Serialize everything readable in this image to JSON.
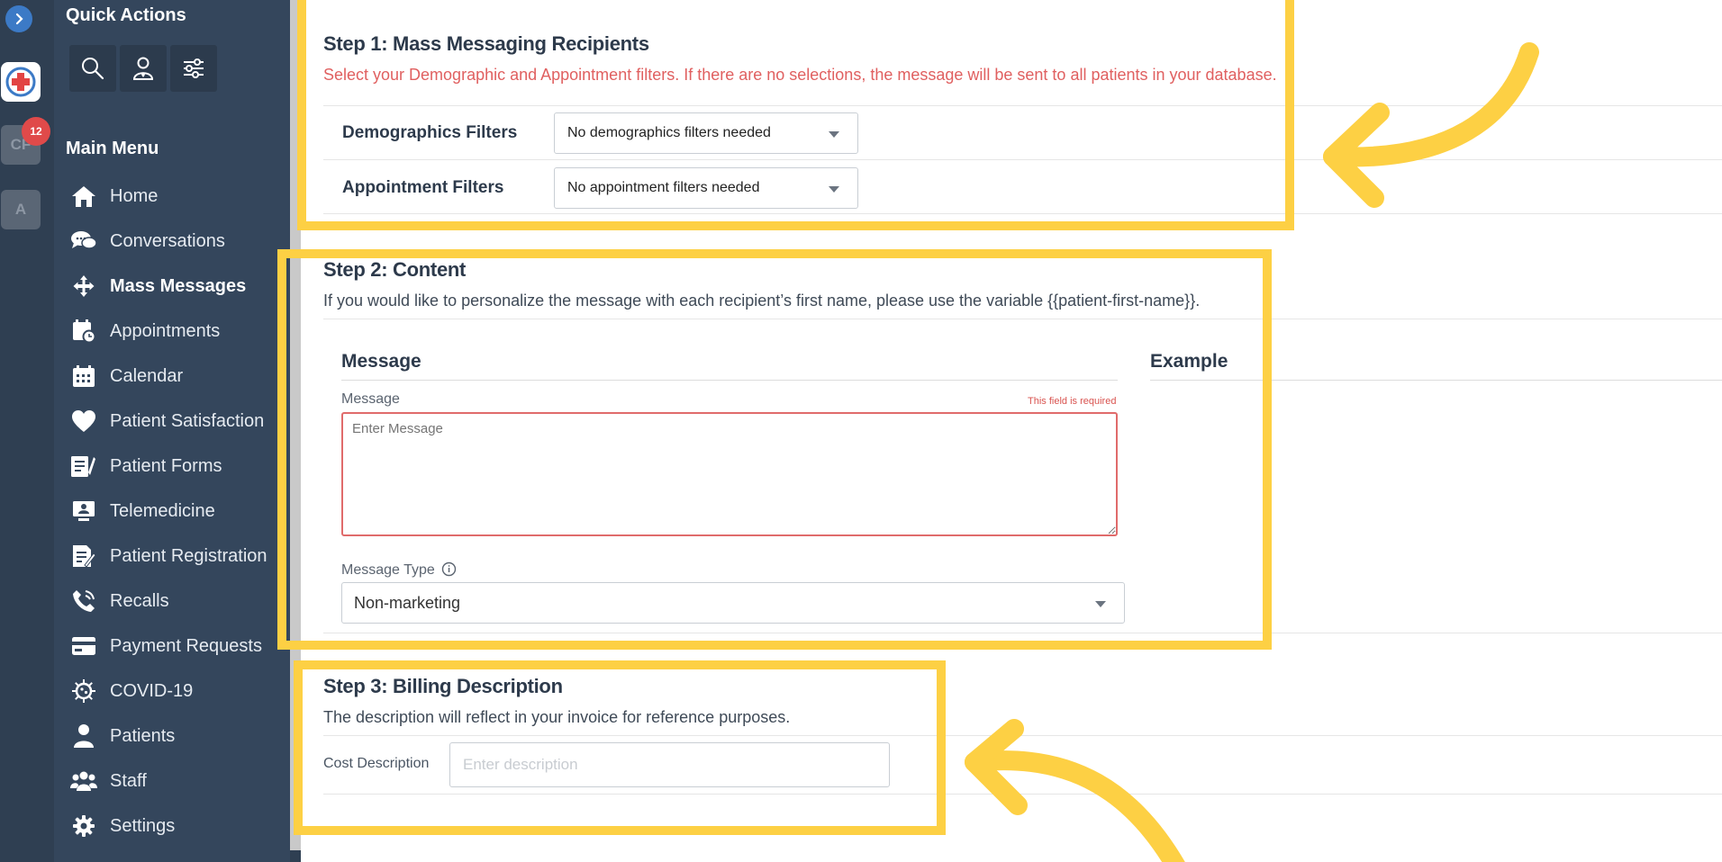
{
  "rail": {
    "tile_cf": "CF",
    "badge": "12",
    "tile_a": "A"
  },
  "sidebar": {
    "quick_actions_title": "Quick Actions",
    "main_menu_title": "Main Menu",
    "items": [
      {
        "label": "Home",
        "icon": "home-icon"
      },
      {
        "label": "Conversations",
        "icon": "chat-icon"
      },
      {
        "label": "Mass Messages",
        "icon": "broadcast-icon",
        "active": true
      },
      {
        "label": "Appointments",
        "icon": "appointment-icon"
      },
      {
        "label": "Calendar",
        "icon": "calendar-icon"
      },
      {
        "label": "Patient Satisfaction",
        "icon": "heart-icon"
      },
      {
        "label": "Patient Forms",
        "icon": "forms-icon"
      },
      {
        "label": "Telemedicine",
        "icon": "telemedicine-icon"
      },
      {
        "label": "Patient Registration",
        "icon": "registration-icon"
      },
      {
        "label": "Recalls",
        "icon": "phone-icon"
      },
      {
        "label": "Payment Requests",
        "icon": "card-icon"
      },
      {
        "label": "COVID-19",
        "icon": "virus-icon"
      },
      {
        "label": "Patients",
        "icon": "patient-icon"
      },
      {
        "label": "Staff",
        "icon": "staff-icon"
      },
      {
        "label": "Settings",
        "icon": "gear-icon"
      }
    ]
  },
  "step1": {
    "title": "Step 1: Mass Messaging Recipients",
    "description": "Select your Demographic and Appointment filters. If there are no selections, the message will be sent to all patients in your database.",
    "demographics_label": "Demographics Filters",
    "demographics_value": "No demographics filters needed",
    "appointment_label": "Appointment Filters",
    "appointment_value": "No appointment filters needed"
  },
  "step2": {
    "title": "Step 2: Content",
    "description": "If you would like to personalize the message with each recipient’s first name, please use the variable {{patient-first-name}}.",
    "message_heading": "Message",
    "example_heading": "Example",
    "message_label": "Message",
    "required_text": "This field is required",
    "message_placeholder": "Enter Message",
    "message_type_label": "Message Type",
    "message_type_value": "Non-marketing"
  },
  "step3": {
    "title": "Step 3: Billing Description",
    "description": "The description will reflect in your invoice for reference purposes.",
    "cost_label": "Cost Description",
    "cost_placeholder": "Enter description"
  },
  "colors": {
    "highlight": "#fdd044",
    "sidebar": "#34465c",
    "warn": "#e06060"
  }
}
